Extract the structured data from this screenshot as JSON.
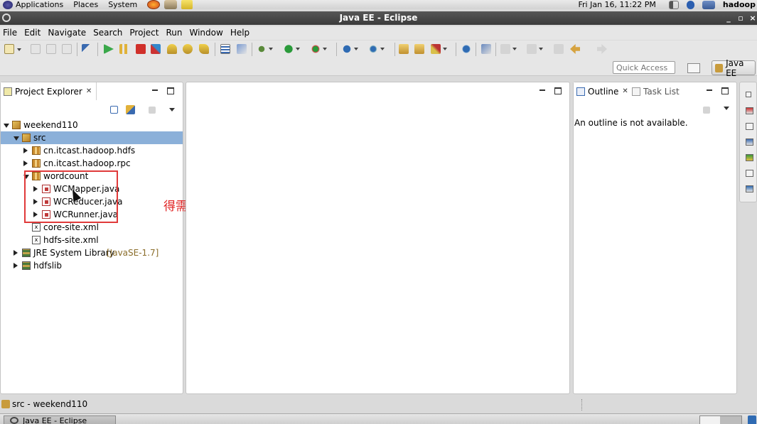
{
  "top_panel": {
    "menus": [
      "Applications",
      "Places",
      "System"
    ],
    "clock": "Fri Jan 16, 11:22 PM",
    "user": "hadoop",
    "icons": [
      "gnome-foot-icon",
      "firefox-icon",
      "mail-icon",
      "notes-icon",
      "volume-icon",
      "bluetooth-icon",
      "network-icon"
    ]
  },
  "window": {
    "title": "Java EE - Eclipse",
    "controls": [
      "_",
      "▫",
      "×"
    ]
  },
  "menu_bar": [
    "File",
    "Edit",
    "Navigate",
    "Search",
    "Project",
    "Run",
    "Window",
    "Help"
  ],
  "toolbar": {
    "quick_access_placeholder": "Quick Access",
    "perspective_label": "Java EE"
  },
  "project_explorer": {
    "tab_label": "Project Explorer",
    "close_glyph": "✕",
    "tree": [
      {
        "label": "weekend110",
        "depth": 0,
        "twisty": "expanded",
        "icon": "project"
      },
      {
        "label": "src",
        "depth": 1,
        "twisty": "expanded",
        "icon": "src",
        "selected": true
      },
      {
        "label": "cn.itcast.hadoop.hdfs",
        "depth": 2,
        "twisty": "collapsed",
        "icon": "package"
      },
      {
        "label": "cn.itcast.hadoop.rpc",
        "depth": 2,
        "twisty": "collapsed",
        "icon": "package"
      },
      {
        "label": "wordcount",
        "depth": 2,
        "twisty": "expanded",
        "icon": "package"
      },
      {
        "label": "WCMapper.java",
        "depth": 3,
        "twisty": "collapsed",
        "icon": "java"
      },
      {
        "label": "WCReducer.java",
        "depth": 3,
        "twisty": "collapsed",
        "icon": "java"
      },
      {
        "label": "WCRunner.java",
        "depth": 3,
        "twisty": "collapsed",
        "icon": "java"
      },
      {
        "label": "core-site.xml",
        "depth": 2,
        "twisty": "none",
        "icon": "xml"
      },
      {
        "label": "hdfs-site.xml",
        "depth": 2,
        "twisty": "none",
        "icon": "xml"
      },
      {
        "label": "JRE System Library",
        "suffix": "[JavaSE-1.7]",
        "depth": 1,
        "twisty": "collapsed",
        "icon": "lib"
      },
      {
        "label": "hdfslib",
        "depth": 1,
        "twisty": "collapsed",
        "icon": "lib"
      }
    ]
  },
  "annotation": {
    "text": "得需更改下",
    "color": "#e02424"
  },
  "outline": {
    "tabs": [
      {
        "label": "Outline",
        "active": true,
        "close_glyph": "✕"
      },
      {
        "label": "Task List",
        "active": false
      }
    ],
    "message": "An outline is not available."
  },
  "status_bar": {
    "text": "src - weekend110"
  },
  "taskbar": {
    "task_label": "Java EE - Eclipse"
  },
  "colors": {
    "selection": "#8bb0d9",
    "highlight_box": "#e03a3a"
  }
}
